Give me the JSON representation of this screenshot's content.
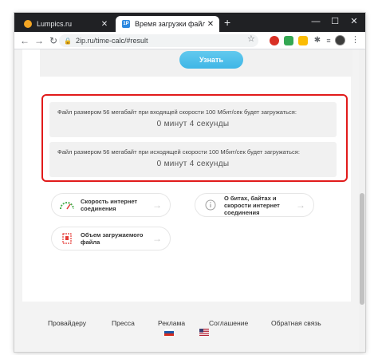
{
  "browser": {
    "tabs": [
      {
        "title": "Lumpics.ru",
        "active": false
      },
      {
        "title": "Время загрузки файла",
        "active": true,
        "favicon_text": "1P"
      }
    ],
    "new_tab": "+",
    "address": "2ip.ru/time-calc/#result",
    "window_controls": {
      "minimize": "—",
      "maximize": "☐",
      "close": "✕"
    }
  },
  "page": {
    "submit_label": "Узнать",
    "results": [
      {
        "label": "Файл размером 56 мегабайт при входящей скорости 100 Мбит/сек будет загружаться:",
        "value": "0 минут 4 секунды"
      },
      {
        "label": "Файл размером 56 мегабайт при исходящей скорости 100 Мбит/сек будет загружаться:",
        "value": "0 минут 4 секунды"
      }
    ],
    "cards": [
      {
        "text": "Скорость интернет соединения",
        "icon": "speedometer-icon"
      },
      {
        "text": "О битах, байтах и скорости интернет соединения",
        "icon": "info-icon"
      },
      {
        "text": "Объем загружаемого файла",
        "icon": "file-size-icon"
      }
    ],
    "card_arrow": "→",
    "footer_links": [
      "Провайдеру",
      "Пресса",
      "Реклама",
      "Соглашение",
      "Обратная связь"
    ]
  },
  "colors": {
    "accent": "#4cbde9",
    "highlight": "#e11b1b",
    "tab_bar": "#202124"
  }
}
